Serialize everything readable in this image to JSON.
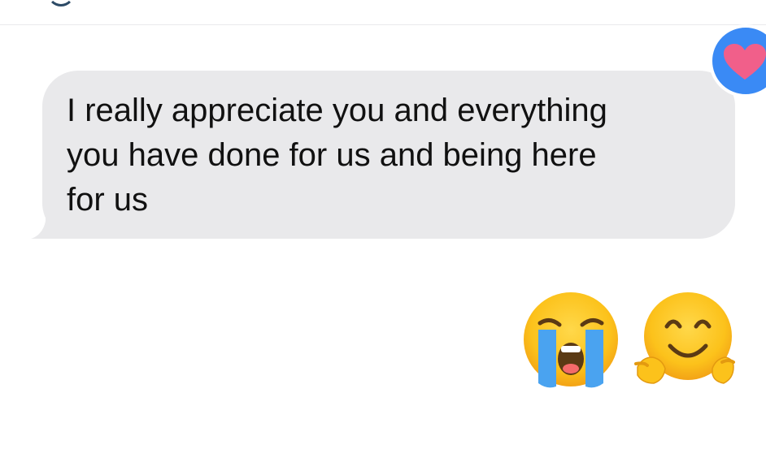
{
  "conversation": {
    "incoming_message": {
      "text": "I really appreciate you and everything\nyou have done for us and being here\nfor us",
      "bubble_color": "#e9e9eb",
      "reaction": {
        "icon": "heart-icon",
        "background": "#3a8af5",
        "heart_color": "#f15f8a"
      }
    },
    "emoji_message": {
      "emojis": [
        {
          "name": "loudly-crying-face",
          "glyph": "😭"
        },
        {
          "name": "hugging-face",
          "glyph": "🤗"
        }
      ]
    }
  }
}
